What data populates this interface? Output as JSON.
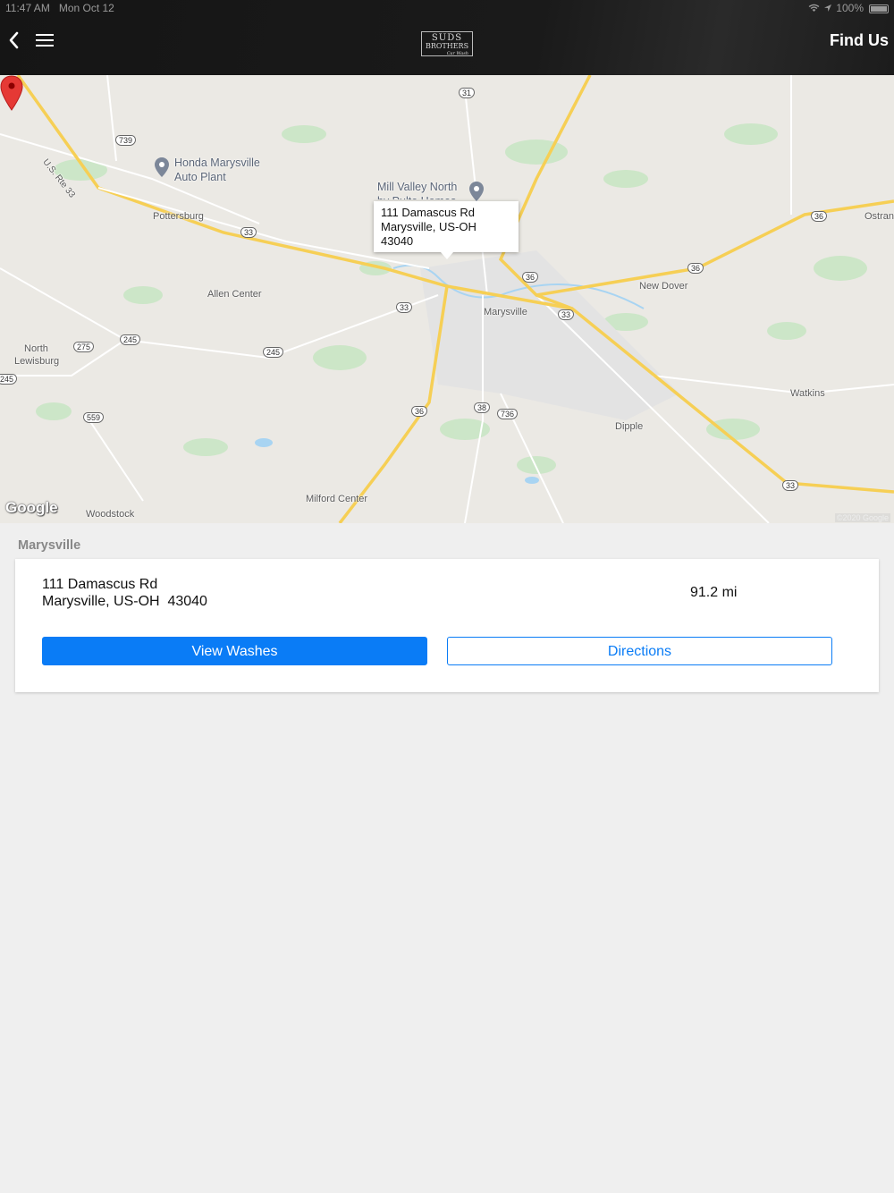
{
  "status_bar": {
    "time": "11:47 AM",
    "date": "Mon Oct 12",
    "battery": "100%"
  },
  "header": {
    "title": "Find Us",
    "logo": {
      "line1": "SUDS",
      "line2": "BROTHERS",
      "line3": "Car Wash"
    },
    "icons": {
      "back": "chevron-left-icon",
      "menu": "hamburger-icon"
    }
  },
  "map": {
    "callout": {
      "line1": "111 Damascus Rd",
      "line2": "Marysville, US-OH",
      "line3": "43040"
    },
    "pois": [
      {
        "line1": "Honda Marysville",
        "line2": "Auto Plant"
      },
      {
        "line1": "Mill Valley North",
        "line2": "by Pulte Homes"
      }
    ],
    "places": [
      "Pottersburg",
      "Allen Center",
      "North",
      "Lewisburg",
      "Marysville",
      "New Dover",
      "Ostran",
      "Watkins",
      "Dipple",
      "Milford Center",
      "Woodstock"
    ],
    "road_label": "U.S. Rte 33",
    "shields": [
      "31",
      "739",
      "33",
      "36",
      "36",
      "36",
      "33",
      "33",
      "275",
      "245",
      "245",
      "245",
      "559",
      "36",
      "38",
      "736",
      "33"
    ],
    "google_logo": "Google",
    "attribution": "©2020 Google"
  },
  "section": {
    "label": "Marysville"
  },
  "location": {
    "address_line1": "111 Damascus Rd",
    "address_line2": "Marysville, US-OH  43040",
    "distance": "91.2 mi",
    "view_washes_label": "View Washes",
    "directions_label": "Directions"
  },
  "colors": {
    "accent": "#0a7cf6",
    "header_bg": "#1a1a1a",
    "pin": "#e53935",
    "background": "#efefef"
  }
}
